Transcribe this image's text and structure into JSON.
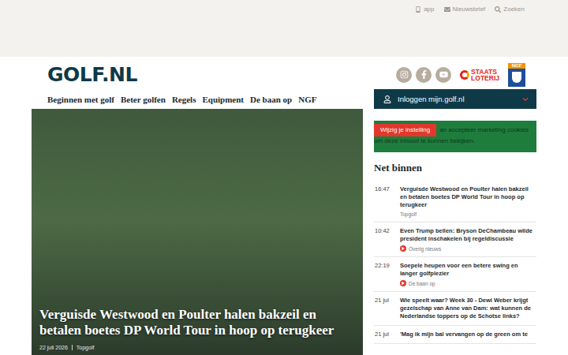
{
  "utility_links": [
    {
      "label": "app",
      "icon": "app"
    },
    {
      "label": "Nieuwsbrief",
      "icon": "mail"
    },
    {
      "label": "Zoeken",
      "icon": "search"
    }
  ],
  "logo": "GOLF.NL",
  "sponsor": {
    "line1": "STAATS",
    "line2": "LOTERIJ"
  },
  "ngf_logo": "NGF",
  "nav": [
    "Beginnen met golf",
    "Beter golfen",
    "Regels",
    "Equipment",
    "De baan op",
    "NGF"
  ],
  "login": {
    "label": "Inloggen mijn.golf.nl"
  },
  "hero": {
    "title": "Verguisde Westwood en Poulter halen bakzeil en betalen boetes DP World Tour in hoop op terugkeer",
    "date": "22 juli 2026",
    "category": "Topgolf"
  },
  "cookie_notice": {
    "button": "Wijzig je instelling",
    "text": "an accepteer marketing cookies om deze inhoud te kunnen bekijken."
  },
  "news": {
    "heading": "Net binnen",
    "items": [
      {
        "time": "16:47",
        "title": "Verguisde Westwood en Poulter halen bakzeil en betalen boetes DP World Tour in hoop op terugkeer",
        "category": "Topgolf",
        "has_icon": false
      },
      {
        "time": "10:42",
        "title": "Even Trump bellen: Bryson DeChambeau wilde president inschakelen bij regeldiscussie",
        "category": "Overig nieuws",
        "has_icon": true
      },
      {
        "time": "22:19",
        "title": "Soepele heupen voor een betere swing en langer golfplezier",
        "category": "De baan op",
        "has_icon": true
      },
      {
        "time": "21 jul",
        "title": "Wie speelt waar? Week 30 - Dewi Weber krijgt gezelschap van Anne van Dam: wat kunnen de Nederlandse toppers op de Schotse links?",
        "category": "",
        "has_icon": false
      },
      {
        "time": "21 jul",
        "title": "'Mag ik mijn bal vervangen op de green om te",
        "category": "",
        "has_icon": false
      }
    ]
  }
}
